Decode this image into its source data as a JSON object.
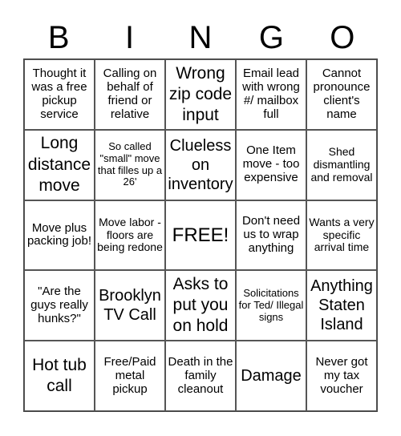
{
  "header": {
    "letters": [
      "B",
      "I",
      "N",
      "G",
      "O"
    ]
  },
  "cells": [
    "Thought it was a free pickup service",
    "Calling on behalf of friend or relative",
    "Wrong zip code input",
    "Email lead with wrong #/ mailbox full",
    "Cannot pronounce client's name",
    "Long distance move",
    "So called \"small\" move that filles up a 26'",
    "Clueless on inventory",
    "One Item move - too expensive",
    "Shed dismantling and removal",
    "Move plus packing job!",
    "Move labor - floors are being redone",
    "FREE!",
    "Don't need us to wrap anything",
    "Wants a very specific arrival time",
    "\"Are the guys really hunks?\"",
    "Brooklyn TV Call",
    "Asks to put you on hold",
    "Solicitations for Ted/ Illegal signs",
    "Anything Staten Island",
    "Hot tub call",
    "Free/Paid metal pickup",
    "Death in the family cleanout",
    "Damage",
    "Never got my tax voucher"
  ]
}
